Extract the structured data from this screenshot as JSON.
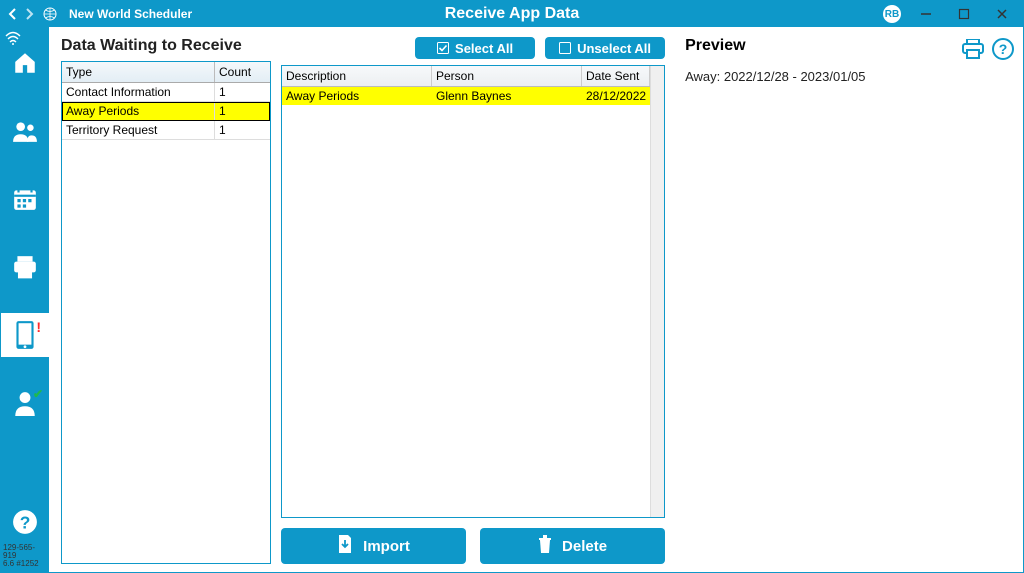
{
  "titlebar": {
    "app_name": "New World Scheduler",
    "page_title": "Receive App Data",
    "avatar": "RB"
  },
  "sidebar": {
    "status_line1": "129-565-919",
    "status_line2": "6.6 #1252"
  },
  "col1": {
    "title": "Data Waiting to Receive",
    "headers": {
      "type": "Type",
      "count": "Count"
    },
    "rows": [
      {
        "type": "Contact Information",
        "count": "1",
        "selected": false
      },
      {
        "type": "Away Periods",
        "count": "1",
        "selected": true
      },
      {
        "type": "Territory Request",
        "count": "1",
        "selected": false
      }
    ]
  },
  "col2": {
    "select_all": "Select All",
    "unselect_all": "Unselect All",
    "headers": {
      "description": "Description",
      "person": "Person",
      "date_sent": "Date Sent"
    },
    "rows": [
      {
        "description": "Away Periods",
        "person": "Glenn Baynes",
        "date_sent": "28/12/2022",
        "selected": true
      }
    ],
    "import": "Import",
    "delete": "Delete"
  },
  "col3": {
    "title": "Preview",
    "text": "Away: 2022/12/28 - 2023/01/05"
  }
}
